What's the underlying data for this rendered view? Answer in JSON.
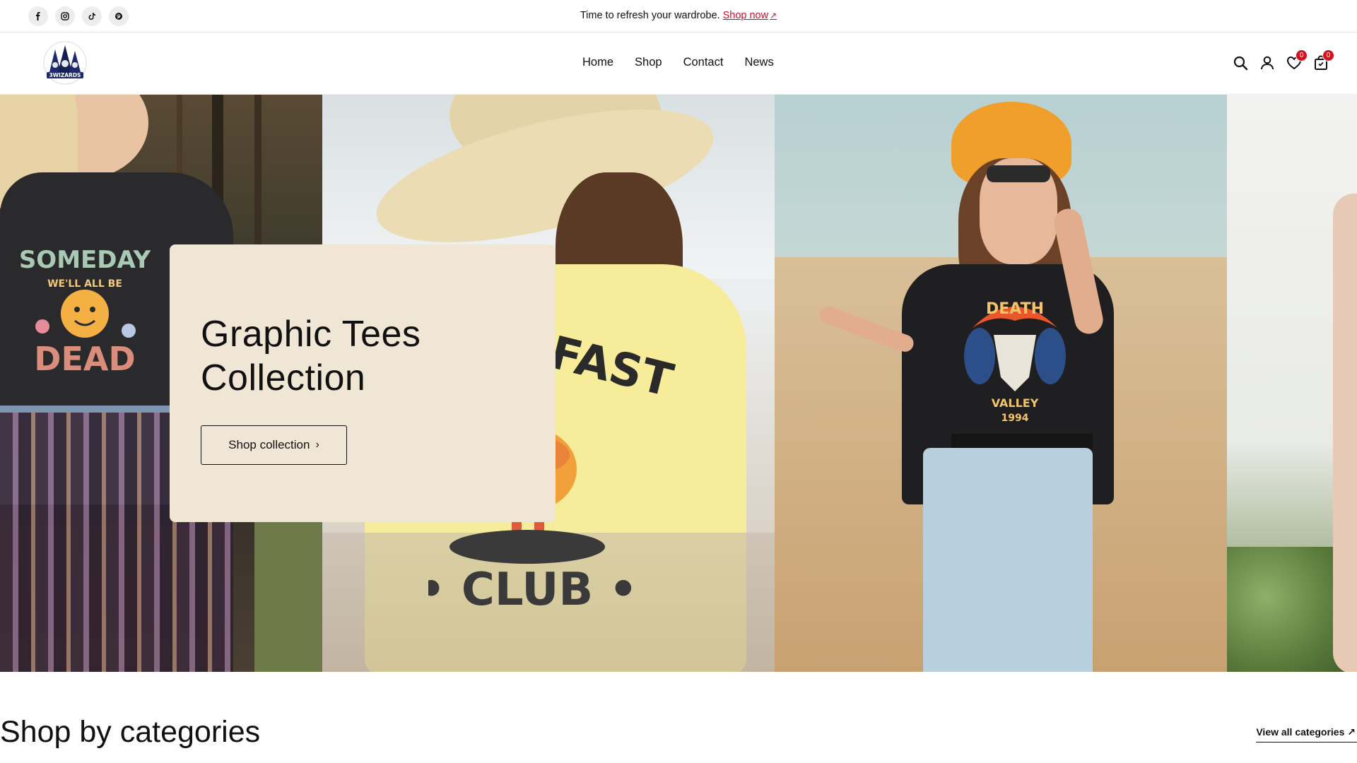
{
  "socials": [
    {
      "name": "facebook-icon",
      "glyph": "f"
    },
    {
      "name": "instagram-icon",
      "glyph": ""
    },
    {
      "name": "tiktok-icon",
      "glyph": ""
    },
    {
      "name": "pinterest-icon",
      "glyph": ""
    }
  ],
  "announcement": {
    "text": "Time to refresh your wardrobe. ",
    "link": "Shop now",
    "link_arrow": "↗"
  },
  "header": {
    "logo_text": "3WIZARDS",
    "nav": [
      "Home",
      "Shop",
      "Contact",
      "News"
    ],
    "wishlist_count": "0",
    "cart_count": "0"
  },
  "hero": {
    "title": "Graphic Tees Collection",
    "button_label": "Shop collection",
    "button_chevron": "›",
    "panel_texts": {
      "tee1_line1": "SOMEDAY",
      "tee1_line2": "WE'LL ALL BE",
      "tee1_line3": "DEAD",
      "tee2_top": "AFAST",
      "tee2_bottom": "• CLUB •",
      "tee3_word": "DEATH",
      "tee3_sub": "VALLEY",
      "tee3_year": "1994"
    }
  },
  "section": {
    "title": "Shop by categories",
    "view_all": "View all categories",
    "view_all_arrow": "↗"
  },
  "colors": {
    "accent": "#c8102e",
    "badge": "#d50f1e",
    "card_bg": "#f0e6d6"
  }
}
